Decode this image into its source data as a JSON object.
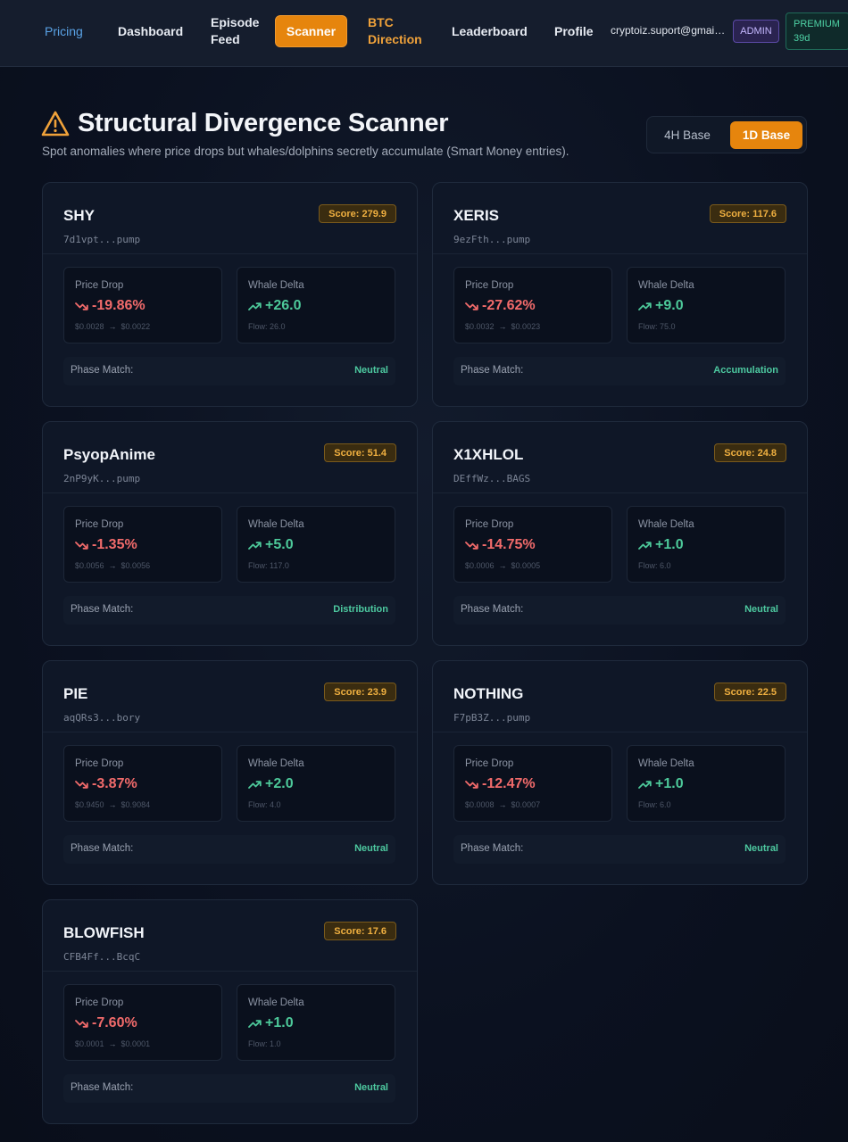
{
  "nav": {
    "pricing": "Pricing",
    "dashboard": "Dashboard",
    "episode_feed": "Episode Feed",
    "scanner": "Scanner",
    "btc_direction": "BTC Direction",
    "leaderboard": "Leaderboard",
    "profile": "Profile",
    "email": "cryptoiz.suport@gmail....",
    "admin_badge": "ADMIN",
    "premium_label": "PREMIUM",
    "premium_days": "39d"
  },
  "header": {
    "title": "Structural Divergence Scanner",
    "subtitle": "Spot anomalies where price drops but whales/dolphins secretly accumulate (Smart Money entries).",
    "toggle_4h": "4H Base",
    "toggle_1d": "1D Base",
    "active_toggle": "1D Base"
  },
  "labels": {
    "price_drop": "Price Drop",
    "whale_delta": "Whale Delta",
    "phase_match": "Phase Match:"
  },
  "colors": {
    "accent": "#e6850d",
    "negative": "#f26b6b",
    "positive": "#4dc99a",
    "score": "#f0b040"
  },
  "cards": [
    {
      "symbol": "SHY",
      "address": "7d1vpt...pump",
      "score": "Score: 279.9",
      "drop": "-19.86%",
      "from": "$0.0028",
      "to": "$0.0022",
      "delta": "+26.0",
      "flow": "Flow: 26.0",
      "phase": "Neutral"
    },
    {
      "symbol": "XERIS",
      "address": "9ezFth...pump",
      "score": "Score: 117.6",
      "drop": "-27.62%",
      "from": "$0.0032",
      "to": "$0.0023",
      "delta": "+9.0",
      "flow": "Flow: 75.0",
      "phase": "Accumulation"
    },
    {
      "symbol": "PsyopAnime",
      "address": "2nP9yK...pump",
      "score": "Score: 51.4",
      "drop": "-1.35%",
      "from": "$0.0056",
      "to": "$0.0056",
      "delta": "+5.0",
      "flow": "Flow: 117.0",
      "phase": "Distribution"
    },
    {
      "symbol": "X1XHLOL",
      "address": "DEffWz...BAGS",
      "score": "Score: 24.8",
      "drop": "-14.75%",
      "from": "$0.0006",
      "to": "$0.0005",
      "delta": "+1.0",
      "flow": "Flow: 6.0",
      "phase": "Neutral"
    },
    {
      "symbol": "PIE",
      "address": "aqQRs3...bory",
      "score": "Score: 23.9",
      "drop": "-3.87%",
      "from": "$0.9450",
      "to": "$0.9084",
      "delta": "+2.0",
      "flow": "Flow: 4.0",
      "phase": "Neutral"
    },
    {
      "symbol": "NOTHING",
      "address": "F7pB3Z...pump",
      "score": "Score: 22.5",
      "drop": "-12.47%",
      "from": "$0.0008",
      "to": "$0.0007",
      "delta": "+1.0",
      "flow": "Flow: 6.0",
      "phase": "Neutral"
    },
    {
      "symbol": "BLOWFISH",
      "address": "CFB4Ff...BcqC",
      "score": "Score: 17.6",
      "drop": "-7.60%",
      "from": "$0.0001",
      "to": "$0.0001",
      "delta": "+1.0",
      "flow": "Flow: 1.0",
      "phase": "Neutral"
    }
  ]
}
